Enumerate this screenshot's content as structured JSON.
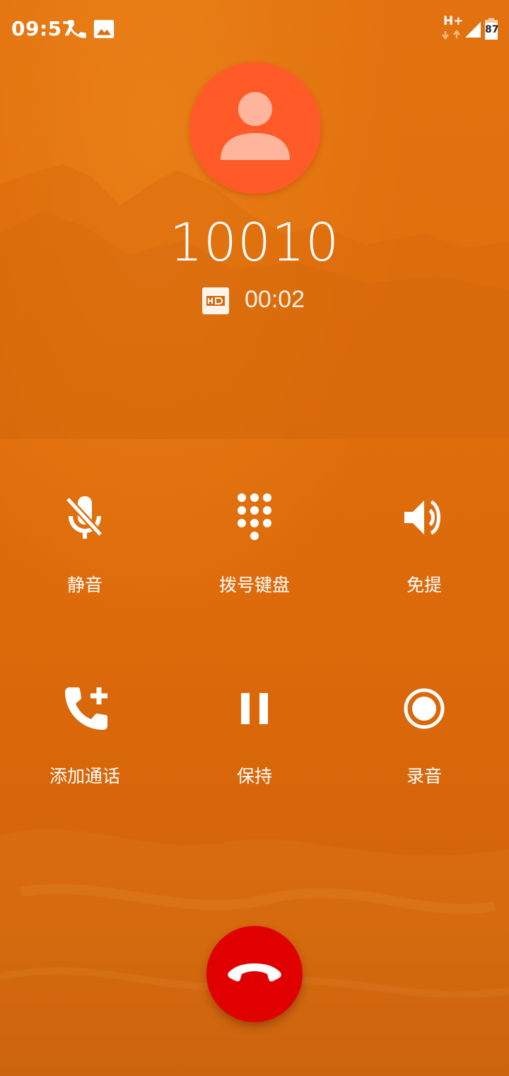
{
  "status_bar": {
    "time": "09:57",
    "network_type": "H+",
    "battery_level": "87",
    "icons": [
      "phone-call-icon",
      "image-notification-icon",
      "data-arrows-icon",
      "signal-icon",
      "battery-icon"
    ]
  },
  "call": {
    "caller_number": "10010",
    "hd_label": "HD",
    "duration": "00:02",
    "avatar_icon": "person-icon"
  },
  "controls": [
    {
      "label": "静音",
      "icon": "mic-off-icon"
    },
    {
      "label": "拨号键盘",
      "icon": "dialpad-icon"
    },
    {
      "label": "免提",
      "icon": "speaker-icon"
    },
    {
      "label": "添加通话",
      "icon": "add-call-icon"
    },
    {
      "label": "保持",
      "icon": "pause-icon"
    },
    {
      "label": "录音",
      "icon": "record-icon"
    }
  ],
  "end_call": {
    "icon": "end-call-icon"
  },
  "colors": {
    "background": "#e06e0c",
    "avatar": "#ff5a28",
    "end_call": "#e00000",
    "foreground": "#ffffff"
  }
}
